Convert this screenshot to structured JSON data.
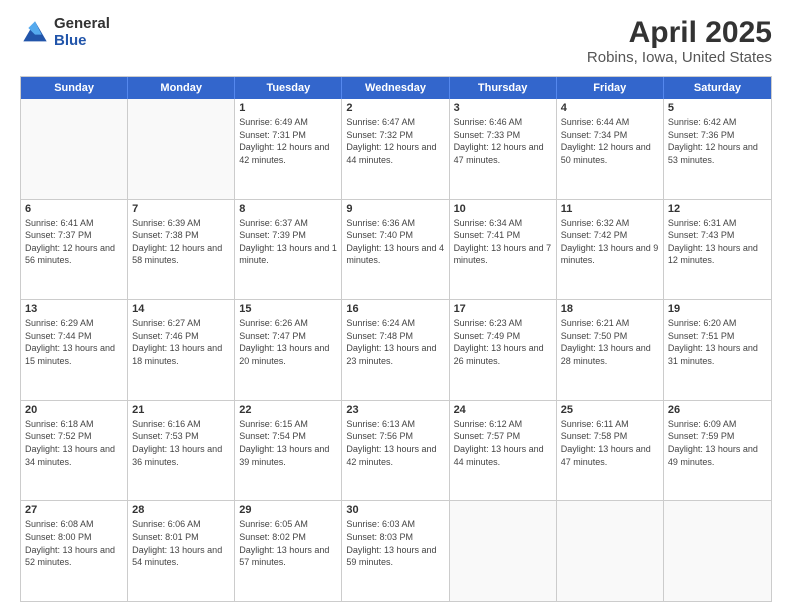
{
  "header": {
    "logo": {
      "line1": "General",
      "line2": "Blue"
    },
    "title": "April 2025",
    "subtitle": "Robins, Iowa, United States"
  },
  "weekdays": [
    "Sunday",
    "Monday",
    "Tuesday",
    "Wednesday",
    "Thursday",
    "Friday",
    "Saturday"
  ],
  "weeks": [
    [
      {
        "day": "",
        "sunrise": "",
        "sunset": "",
        "daylight": ""
      },
      {
        "day": "",
        "sunrise": "",
        "sunset": "",
        "daylight": ""
      },
      {
        "day": "1",
        "sunrise": "Sunrise: 6:49 AM",
        "sunset": "Sunset: 7:31 PM",
        "daylight": "Daylight: 12 hours and 42 minutes."
      },
      {
        "day": "2",
        "sunrise": "Sunrise: 6:47 AM",
        "sunset": "Sunset: 7:32 PM",
        "daylight": "Daylight: 12 hours and 44 minutes."
      },
      {
        "day": "3",
        "sunrise": "Sunrise: 6:46 AM",
        "sunset": "Sunset: 7:33 PM",
        "daylight": "Daylight: 12 hours and 47 minutes."
      },
      {
        "day": "4",
        "sunrise": "Sunrise: 6:44 AM",
        "sunset": "Sunset: 7:34 PM",
        "daylight": "Daylight: 12 hours and 50 minutes."
      },
      {
        "day": "5",
        "sunrise": "Sunrise: 6:42 AM",
        "sunset": "Sunset: 7:36 PM",
        "daylight": "Daylight: 12 hours and 53 minutes."
      }
    ],
    [
      {
        "day": "6",
        "sunrise": "Sunrise: 6:41 AM",
        "sunset": "Sunset: 7:37 PM",
        "daylight": "Daylight: 12 hours and 56 minutes."
      },
      {
        "day": "7",
        "sunrise": "Sunrise: 6:39 AM",
        "sunset": "Sunset: 7:38 PM",
        "daylight": "Daylight: 12 hours and 58 minutes."
      },
      {
        "day": "8",
        "sunrise": "Sunrise: 6:37 AM",
        "sunset": "Sunset: 7:39 PM",
        "daylight": "Daylight: 13 hours and 1 minute."
      },
      {
        "day": "9",
        "sunrise": "Sunrise: 6:36 AM",
        "sunset": "Sunset: 7:40 PM",
        "daylight": "Daylight: 13 hours and 4 minutes."
      },
      {
        "day": "10",
        "sunrise": "Sunrise: 6:34 AM",
        "sunset": "Sunset: 7:41 PM",
        "daylight": "Daylight: 13 hours and 7 minutes."
      },
      {
        "day": "11",
        "sunrise": "Sunrise: 6:32 AM",
        "sunset": "Sunset: 7:42 PM",
        "daylight": "Daylight: 13 hours and 9 minutes."
      },
      {
        "day": "12",
        "sunrise": "Sunrise: 6:31 AM",
        "sunset": "Sunset: 7:43 PM",
        "daylight": "Daylight: 13 hours and 12 minutes."
      }
    ],
    [
      {
        "day": "13",
        "sunrise": "Sunrise: 6:29 AM",
        "sunset": "Sunset: 7:44 PM",
        "daylight": "Daylight: 13 hours and 15 minutes."
      },
      {
        "day": "14",
        "sunrise": "Sunrise: 6:27 AM",
        "sunset": "Sunset: 7:46 PM",
        "daylight": "Daylight: 13 hours and 18 minutes."
      },
      {
        "day": "15",
        "sunrise": "Sunrise: 6:26 AM",
        "sunset": "Sunset: 7:47 PM",
        "daylight": "Daylight: 13 hours and 20 minutes."
      },
      {
        "day": "16",
        "sunrise": "Sunrise: 6:24 AM",
        "sunset": "Sunset: 7:48 PM",
        "daylight": "Daylight: 13 hours and 23 minutes."
      },
      {
        "day": "17",
        "sunrise": "Sunrise: 6:23 AM",
        "sunset": "Sunset: 7:49 PM",
        "daylight": "Daylight: 13 hours and 26 minutes."
      },
      {
        "day": "18",
        "sunrise": "Sunrise: 6:21 AM",
        "sunset": "Sunset: 7:50 PM",
        "daylight": "Daylight: 13 hours and 28 minutes."
      },
      {
        "day": "19",
        "sunrise": "Sunrise: 6:20 AM",
        "sunset": "Sunset: 7:51 PM",
        "daylight": "Daylight: 13 hours and 31 minutes."
      }
    ],
    [
      {
        "day": "20",
        "sunrise": "Sunrise: 6:18 AM",
        "sunset": "Sunset: 7:52 PM",
        "daylight": "Daylight: 13 hours and 34 minutes."
      },
      {
        "day": "21",
        "sunrise": "Sunrise: 6:16 AM",
        "sunset": "Sunset: 7:53 PM",
        "daylight": "Daylight: 13 hours and 36 minutes."
      },
      {
        "day": "22",
        "sunrise": "Sunrise: 6:15 AM",
        "sunset": "Sunset: 7:54 PM",
        "daylight": "Daylight: 13 hours and 39 minutes."
      },
      {
        "day": "23",
        "sunrise": "Sunrise: 6:13 AM",
        "sunset": "Sunset: 7:56 PM",
        "daylight": "Daylight: 13 hours and 42 minutes."
      },
      {
        "day": "24",
        "sunrise": "Sunrise: 6:12 AM",
        "sunset": "Sunset: 7:57 PM",
        "daylight": "Daylight: 13 hours and 44 minutes."
      },
      {
        "day": "25",
        "sunrise": "Sunrise: 6:11 AM",
        "sunset": "Sunset: 7:58 PM",
        "daylight": "Daylight: 13 hours and 47 minutes."
      },
      {
        "day": "26",
        "sunrise": "Sunrise: 6:09 AM",
        "sunset": "Sunset: 7:59 PM",
        "daylight": "Daylight: 13 hours and 49 minutes."
      }
    ],
    [
      {
        "day": "27",
        "sunrise": "Sunrise: 6:08 AM",
        "sunset": "Sunset: 8:00 PM",
        "daylight": "Daylight: 13 hours and 52 minutes."
      },
      {
        "day": "28",
        "sunrise": "Sunrise: 6:06 AM",
        "sunset": "Sunset: 8:01 PM",
        "daylight": "Daylight: 13 hours and 54 minutes."
      },
      {
        "day": "29",
        "sunrise": "Sunrise: 6:05 AM",
        "sunset": "Sunset: 8:02 PM",
        "daylight": "Daylight: 13 hours and 57 minutes."
      },
      {
        "day": "30",
        "sunrise": "Sunrise: 6:03 AM",
        "sunset": "Sunset: 8:03 PM",
        "daylight": "Daylight: 13 hours and 59 minutes."
      },
      {
        "day": "",
        "sunrise": "",
        "sunset": "",
        "daylight": ""
      },
      {
        "day": "",
        "sunrise": "",
        "sunset": "",
        "daylight": ""
      },
      {
        "day": "",
        "sunrise": "",
        "sunset": "",
        "daylight": ""
      }
    ]
  ]
}
